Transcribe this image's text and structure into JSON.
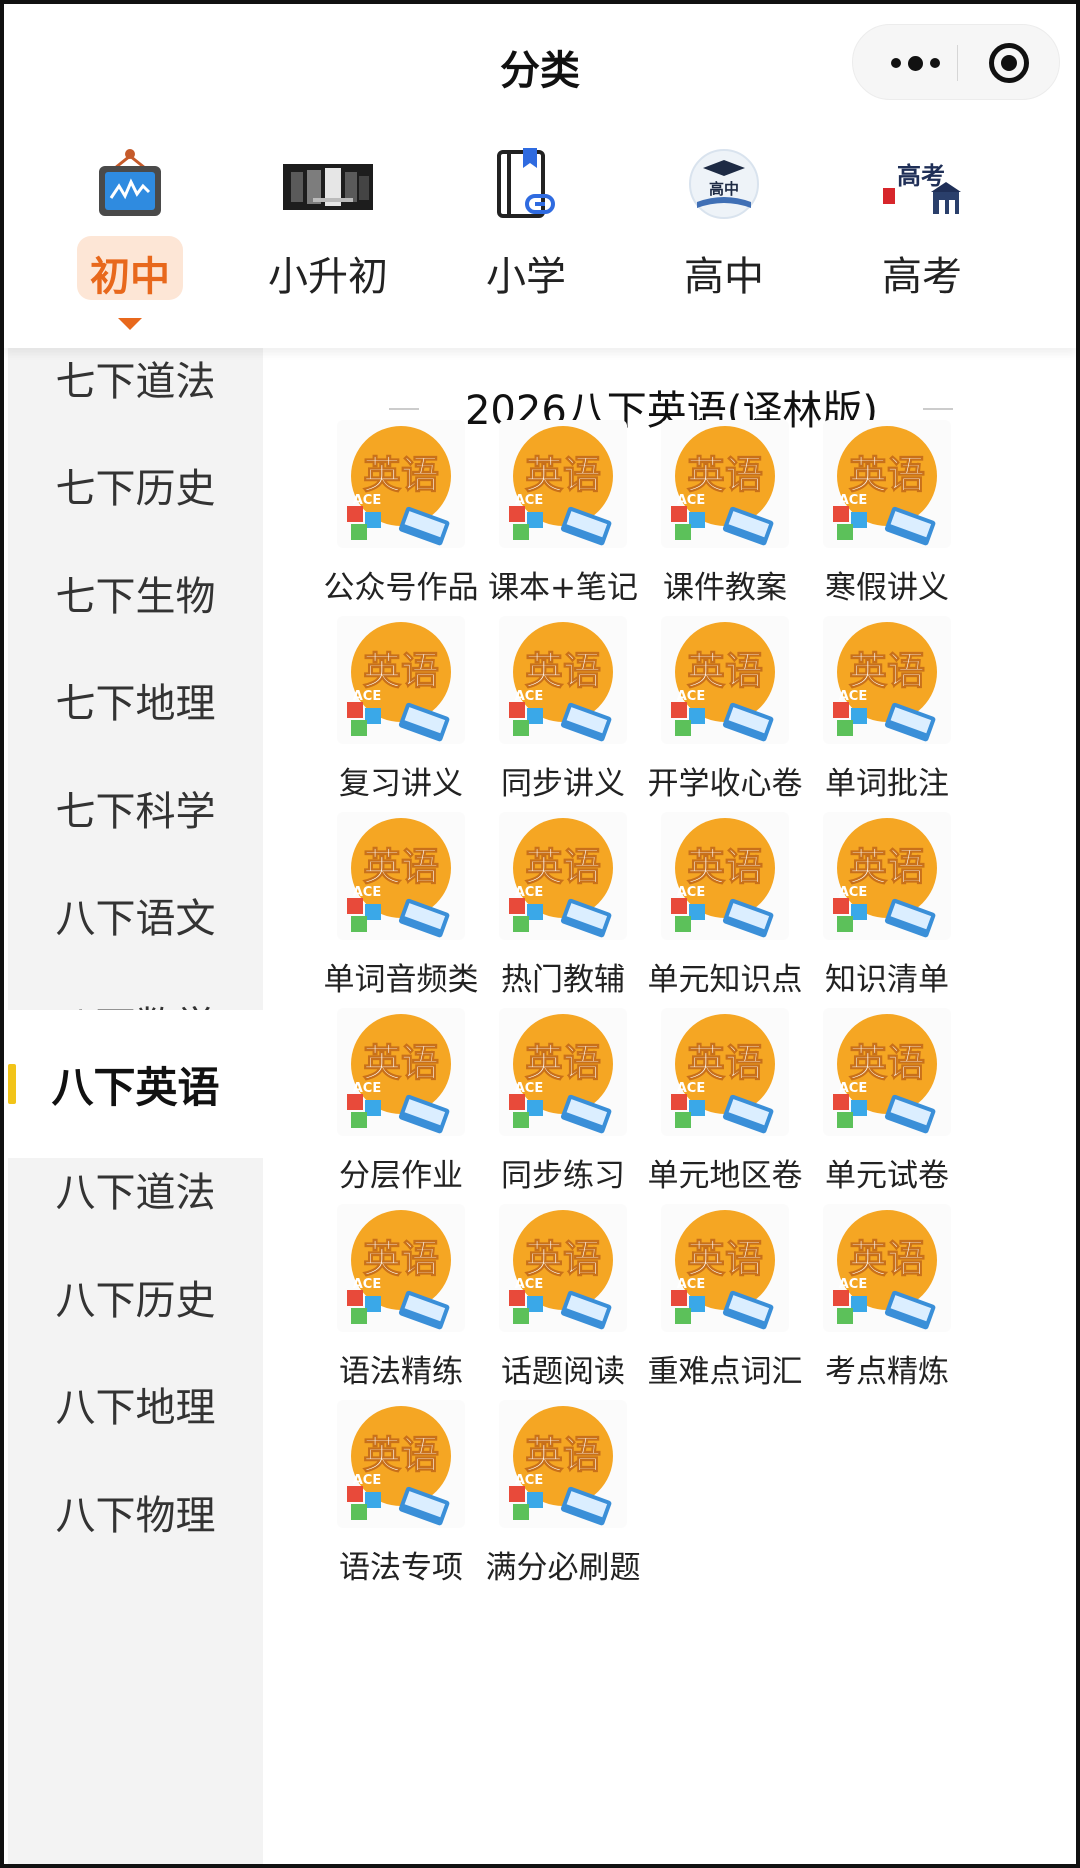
{
  "header": {
    "title": "分类"
  },
  "tabs": [
    {
      "label": "初中",
      "icon": "tv-screen-icon",
      "active": true
    },
    {
      "label": "小升初",
      "icon": "promo-banner-icon",
      "active": false
    },
    {
      "label": "小学",
      "icon": "book-link-icon",
      "active": false
    },
    {
      "label": "高中",
      "icon": "graduation-book-icon",
      "active": false
    },
    {
      "label": "高考",
      "icon": "gaokao-gate-icon",
      "active": false
    }
  ],
  "gaokao_icon_text": "高考",
  "gaozhong_icon_text": "高中",
  "sidebar": [
    {
      "label": "七下道法"
    },
    {
      "label": "七下历史"
    },
    {
      "label": "七下生物"
    },
    {
      "label": "七下地理"
    },
    {
      "label": "七下科学"
    },
    {
      "label": "八下语文"
    },
    {
      "label": "八下数学"
    },
    {
      "label": "八下英语",
      "active": true
    },
    {
      "label": "八下道法"
    },
    {
      "label": "八下历史"
    },
    {
      "label": "八下地理"
    },
    {
      "label": "八下物理"
    }
  ],
  "section": {
    "title": "2026八下英语(译林版)"
  },
  "thumb_text": "英语",
  "thumb_letters": "ACE",
  "items": [
    {
      "label": "公众号作品"
    },
    {
      "label": "课本+笔记"
    },
    {
      "label": "课件教案"
    },
    {
      "label": "寒假讲义"
    },
    {
      "label": "复习讲义"
    },
    {
      "label": "同步讲义"
    },
    {
      "label": "开学收心卷"
    },
    {
      "label": "单词批注"
    },
    {
      "label": "单词音频类"
    },
    {
      "label": "热门教辅"
    },
    {
      "label": "单元知识点"
    },
    {
      "label": "知识清单"
    },
    {
      "label": "分层作业"
    },
    {
      "label": "同步练习"
    },
    {
      "label": "单元地区卷"
    },
    {
      "label": "单元试卷"
    },
    {
      "label": "语法精练"
    },
    {
      "label": "话题阅读"
    },
    {
      "label": "重难点词汇"
    },
    {
      "label": "考点精炼"
    },
    {
      "label": "语法专项"
    },
    {
      "label": "满分必刷题"
    }
  ],
  "colors": {
    "accent_orange": "#e8681c",
    "accent_bg": "#fde6d6",
    "indicator_yellow": "#f2c418",
    "thumb_circle": "#f5a623"
  }
}
